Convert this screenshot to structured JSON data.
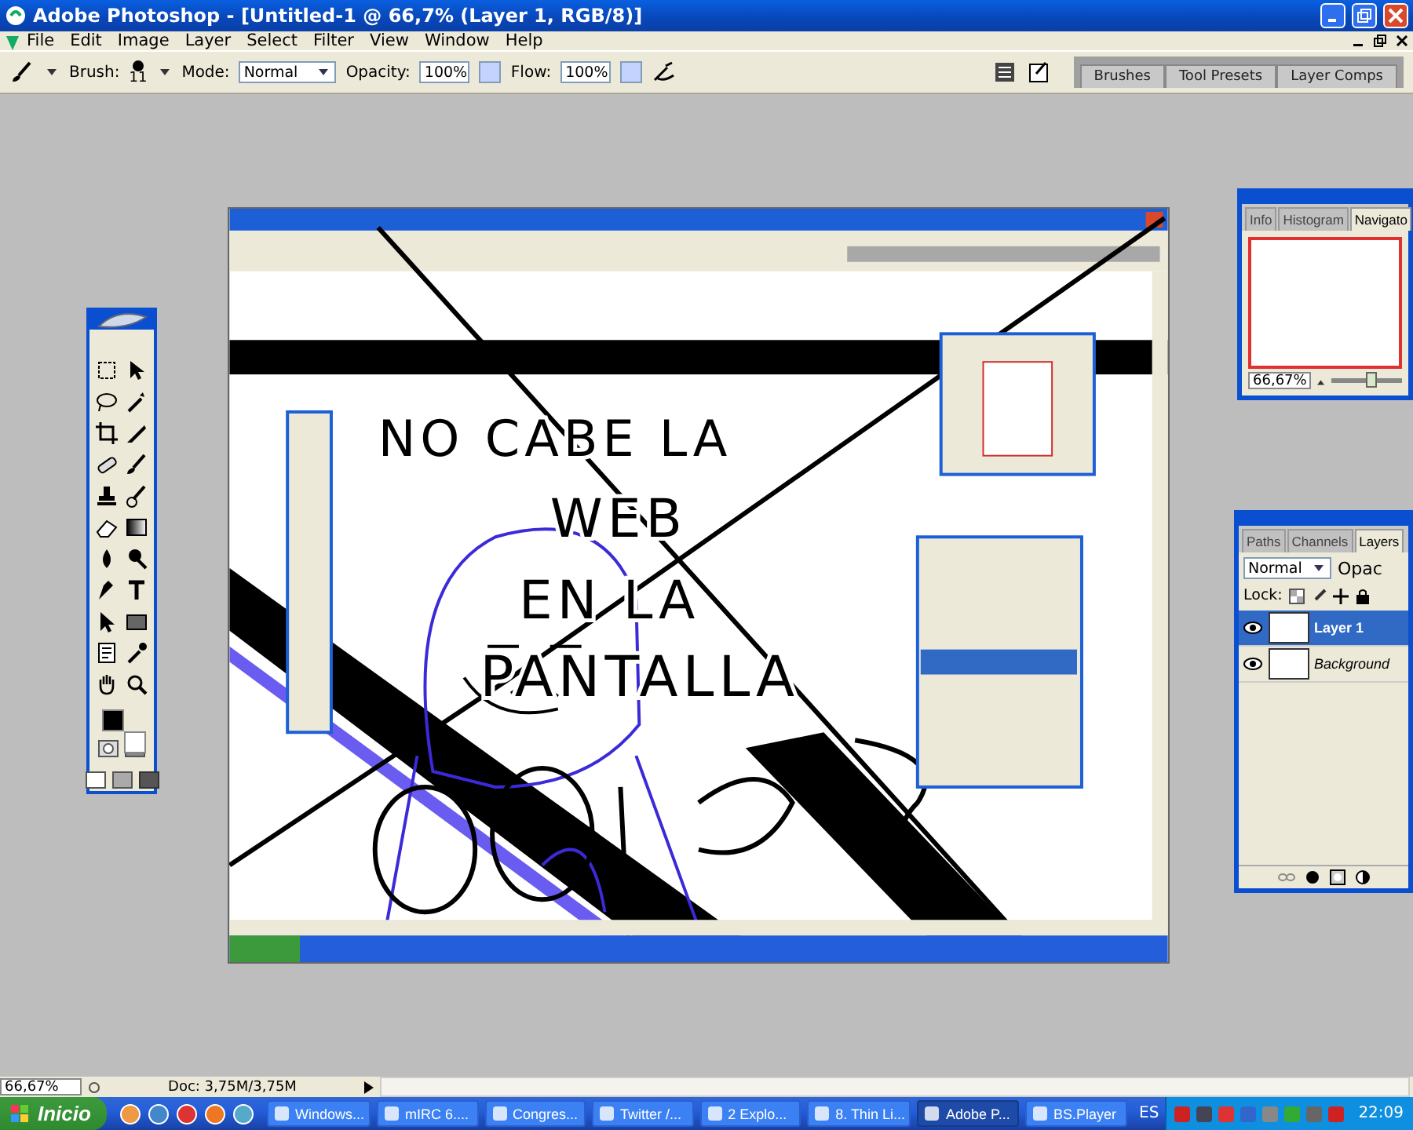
{
  "window": {
    "title": "Adobe Photoshop - [Untitled-1 @ 66,7% (Layer 1, RGB/8)]"
  },
  "menu": [
    "File",
    "Edit",
    "Image",
    "Layer",
    "Select",
    "Filter",
    "View",
    "Window",
    "Help"
  ],
  "options_bar": {
    "brush_label": "Brush:",
    "brush_size": "11",
    "mode_label": "Mode:",
    "mode": "Normal",
    "opacity_label": "Opacity:",
    "opacity": "100%",
    "flow_label": "Flow:",
    "flow": "100%",
    "palette_tabs": [
      "Brushes",
      "Tool Presets",
      "Layer Comps"
    ]
  },
  "canvas": {
    "handwriting": [
      "NO CABE LA",
      "WEB",
      "EN LA",
      "PANTALLA"
    ]
  },
  "navigator": {
    "tabs": [
      {
        "label": "Info",
        "selected": false
      },
      {
        "label": "Histogram",
        "selected": false
      },
      {
        "label": "Navigato",
        "selected": true
      }
    ],
    "zoom": "66,67%",
    "level": 0.55
  },
  "layers": {
    "tabs": [
      {
        "label": "Paths",
        "selected": false
      },
      {
        "label": "Channels",
        "selected": false
      },
      {
        "label": "Layers",
        "selected": true
      }
    ],
    "mode": "Normal",
    "opacity_label": "Opac",
    "lock_label": "Lock:",
    "rows": [
      {
        "name": "Layer 1",
        "kind": "layer",
        "selected": true,
        "visible": true
      },
      {
        "name": "Background",
        "kind": "background",
        "selected": false,
        "visible": true
      }
    ]
  },
  "status_bar": {
    "zoom": "66,67%",
    "doc": "Doc: 3,75M/3,75M"
  },
  "taskbar": {
    "start": "Inicio",
    "tasks": [
      {
        "label": "Windows...",
        "selected": false
      },
      {
        "label": "mIRC 6....",
        "selected": false
      },
      {
        "label": "Congres...",
        "selected": false
      },
      {
        "label": "Twitter /...",
        "selected": false
      },
      {
        "label": "2 Explo...",
        "selected": false
      },
      {
        "label": "8. Thin Li...",
        "selected": false
      },
      {
        "label": "Adobe P...",
        "selected": true
      },
      {
        "label": "BS.Player",
        "selected": false
      }
    ],
    "language": "ES",
    "clock": "22:09"
  }
}
